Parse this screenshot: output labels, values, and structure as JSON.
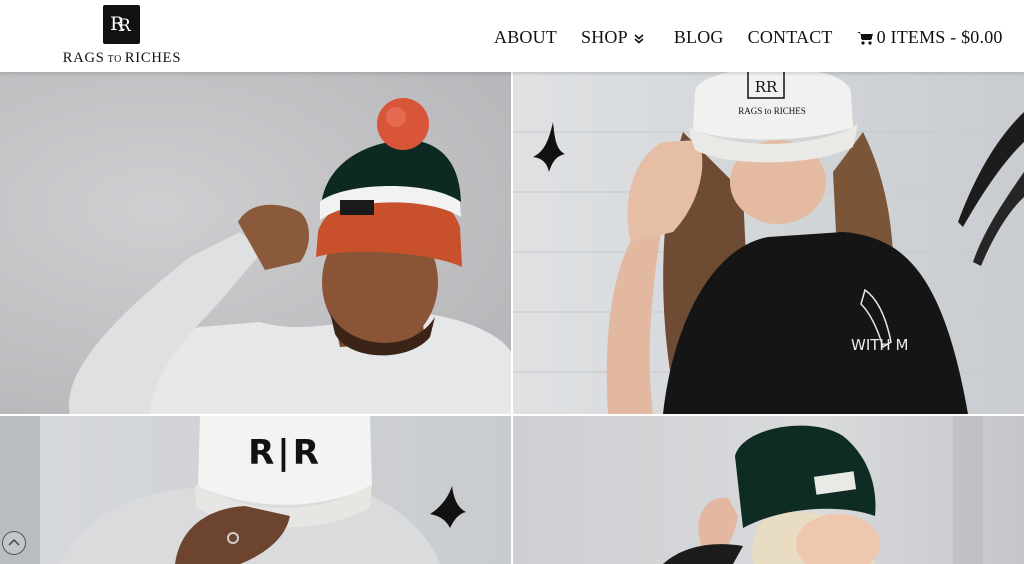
{
  "brand": {
    "logo_text_left": "RAGS",
    "logo_text_mid": "TO",
    "logo_text_right": "RICHES"
  },
  "nav": {
    "about": "ABOUT",
    "shop": "SHOP",
    "blog": "BLOG",
    "contact": "CONTACT",
    "cart": "0 ITEMS - $0.00"
  },
  "photos": {
    "cap_text_rr": "RAGS to RICHES",
    "cap_text_rir": "R|R",
    "shirt_text": "WITH M"
  },
  "colors": {
    "header_bg": "#ffffff",
    "text": "#111111",
    "beanie_orange": "#c8502a",
    "beanie_green": "#0d2a22"
  }
}
